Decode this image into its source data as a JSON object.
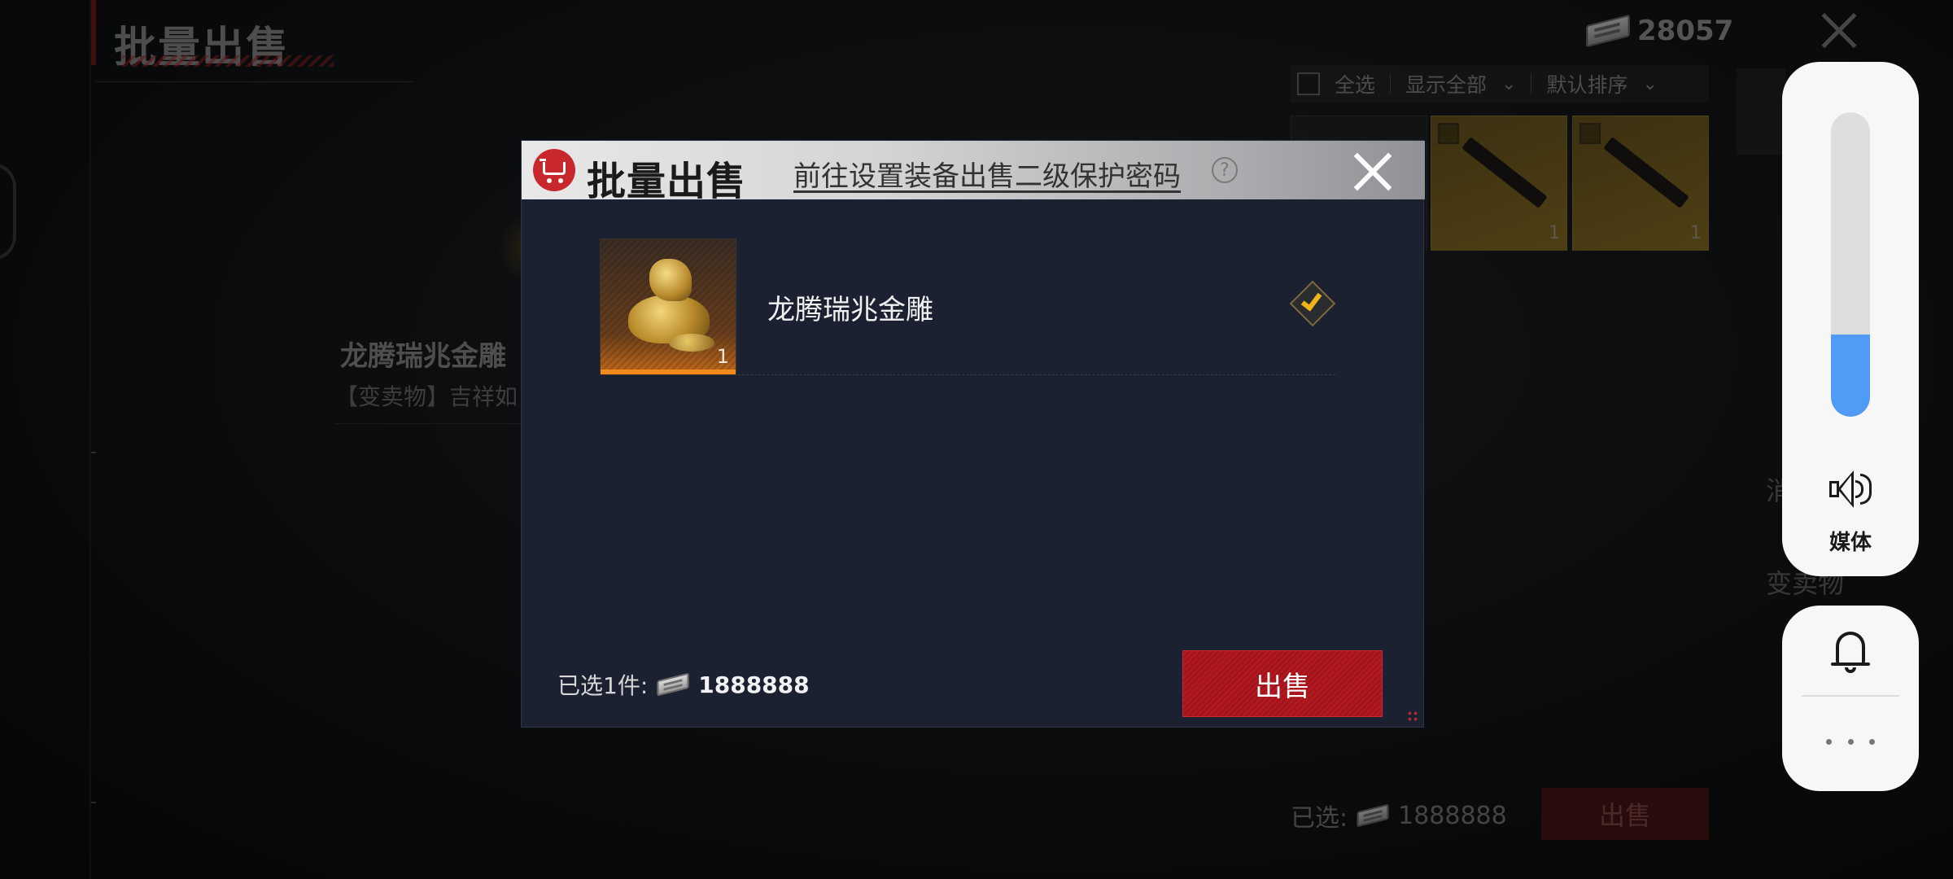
{
  "background": {
    "title": "批量出售",
    "currency_amount": "28057",
    "filter": {
      "select_all": "全选",
      "show_all": "显示全部",
      "sort_default": "默认排序"
    },
    "grid_item_qty": "1",
    "item_name": "龙腾瑞兆金雕",
    "item_desc": "【变卖物】吉祥如",
    "side_label_1": "消",
    "side_label_2": "变卖物",
    "selected_label": "已选:",
    "selected_amount": "1888888",
    "sell_label": "出售"
  },
  "modal": {
    "title": "批量出售",
    "password_link": "前往设置装备出售二级保护密码",
    "help_glyph": "?",
    "items": [
      {
        "name": "龙腾瑞兆金雕",
        "qty": "1",
        "checked": true
      }
    ],
    "footer": {
      "selected_label": "已选1件:",
      "amount": "1888888"
    },
    "sell_button": "出售"
  },
  "system_overlay": {
    "volume_label": "媒体",
    "volume_level": 0.27,
    "accent_color": "#4f9bf5"
  },
  "colors": {
    "sell_red": "#b3171f",
    "modal_bg": "#1b2130",
    "check_gold": "#f0b51c",
    "item_orange": "#f08a1c"
  }
}
